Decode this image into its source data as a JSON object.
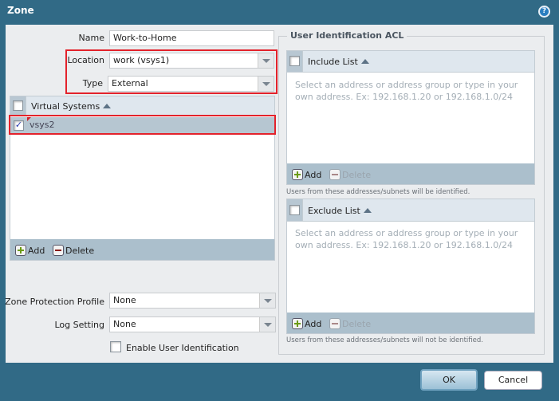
{
  "dialog": {
    "title": "Zone",
    "help_icon": "help-icon"
  },
  "form": {
    "name_label": "Name",
    "name_value": "Work-to-Home",
    "location_label": "Location",
    "location_value": "work (vsys1)",
    "type_label": "Type",
    "type_value": "External",
    "zpp_label": "Zone Protection Profile",
    "zpp_value": "None",
    "log_label": "Log Setting",
    "log_value": "None",
    "enable_uid_label": "Enable User Identification"
  },
  "vsys_grid": {
    "header": "Virtual Systems",
    "rows": [
      {
        "label": "vsys2",
        "checked": true
      }
    ],
    "add": "Add",
    "delete": "Delete"
  },
  "acl": {
    "legend": "User Identification ACL",
    "include": {
      "header": "Include List",
      "placeholder": "Select an address or address group or type in your own address. Ex: 192.168.1.20 or 192.168.1.0/24",
      "add": "Add",
      "delete": "Delete",
      "note": "Users from these addresses/subnets will be identified."
    },
    "exclude": {
      "header": "Exclude List",
      "placeholder": "Select an address or address group or type in your own address. Ex: 192.168.1.20 or 192.168.1.0/24",
      "add": "Add",
      "delete": "Delete",
      "note": "Users from these addresses/subnets will not be identified."
    }
  },
  "footer": {
    "ok": "OK",
    "cancel": "Cancel"
  },
  "colors": {
    "titlebar": "#316a86",
    "highlight": "#e3222b"
  }
}
